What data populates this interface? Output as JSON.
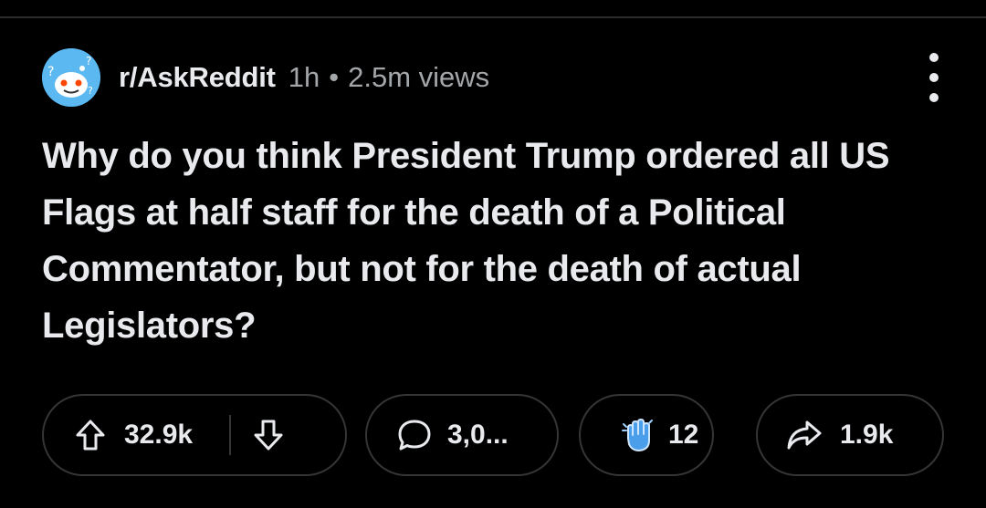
{
  "post": {
    "subreddit": "r/AskReddit",
    "age": "1h",
    "separator": "•",
    "views": "2.5m views",
    "title": "Why do you think President Trump ordered all US Flags at half staff for the death of a Political Commentator, but not for the death of actual Legislators?"
  },
  "actions": {
    "upvotes": "32.9k",
    "comments": "3,0...",
    "awards": "12",
    "shares": "1.9k"
  },
  "icons": {
    "avatar": "subreddit-avatar-icon",
    "more": "more-vertical-icon",
    "upvote": "arrow-up-icon",
    "downvote": "arrow-down-icon",
    "comment": "speech-bubble-icon",
    "award": "clapping-hands-icon",
    "share": "share-arrow-icon"
  },
  "colors": {
    "background": "#000000",
    "text": "#e8eaed",
    "muted": "#a4a7aa",
    "pill_border": "#343536",
    "avatar_bg": "#3fa6e8",
    "award_blue": "#4a9eea"
  }
}
